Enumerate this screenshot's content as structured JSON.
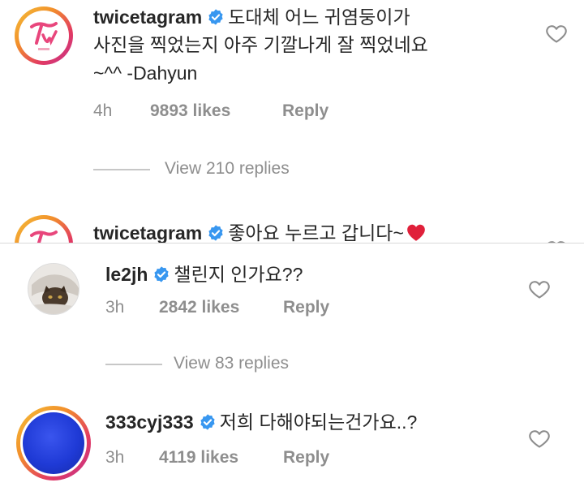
{
  "comments_top": [
    {
      "username": "twicetagram",
      "text_lines": [
        "도대체 어느 귀염둥이가",
        "사진을 찍었는지 아주 기깔나게 잘 찍었네요",
        "~^^ -Dahyun"
      ],
      "time": "4h",
      "likes": "9893 likes",
      "reply_label": "Reply",
      "view_replies": "View 210 replies"
    },
    {
      "username": "twicetagram",
      "text": "좋아요 누르고 갑니다~"
    }
  ],
  "comments_bottom": [
    {
      "username": "le2jh",
      "text": "챌린지 인가요??",
      "time": "3h",
      "likes": "2842 likes",
      "reply_label": "Reply",
      "view_replies": "View 83 replies"
    },
    {
      "username": "333cyj333",
      "text": "저희 다해야되는건가요..?",
      "time": "3h",
      "likes": "4119 likes",
      "reply_label": "Reply"
    }
  ],
  "colors": {
    "verified": "#3897f0",
    "heart_emoji": "#e0203a",
    "avatar_blue": "#1f3ad6"
  },
  "icons": {
    "verified": "verified-badge-icon",
    "like": "heart-outline-icon",
    "emoji": "red-heart-emoji-icon"
  }
}
